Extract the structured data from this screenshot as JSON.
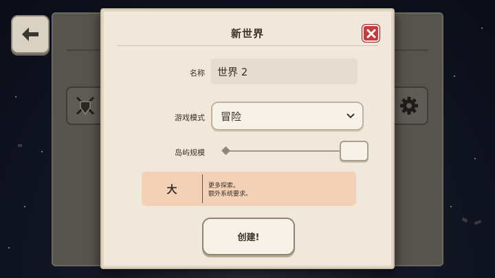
{
  "dialog": {
    "title": "新世界",
    "name_label": "名称",
    "name_value": "世界 2",
    "mode_label": "游戏模式",
    "mode_value": "冒险",
    "size_label": "岛屿规模",
    "size_value": "大",
    "size_slider_fraction": 1.0,
    "size_description_line1": "更多探索。",
    "size_description_line2": "额外系统要求。",
    "create_label": "创建!"
  },
  "icons": {
    "back": "arrow-left-icon",
    "close": "close-icon",
    "dropdown": "chevron-down-icon",
    "combat": "crossed-swords-shield-icon",
    "settings": "gear-icon"
  },
  "colors": {
    "dialog_bg": "#f0e9db",
    "close_red": "#c73b3b",
    "info_bg": "#f3d1b6",
    "text": "#3b3026"
  }
}
